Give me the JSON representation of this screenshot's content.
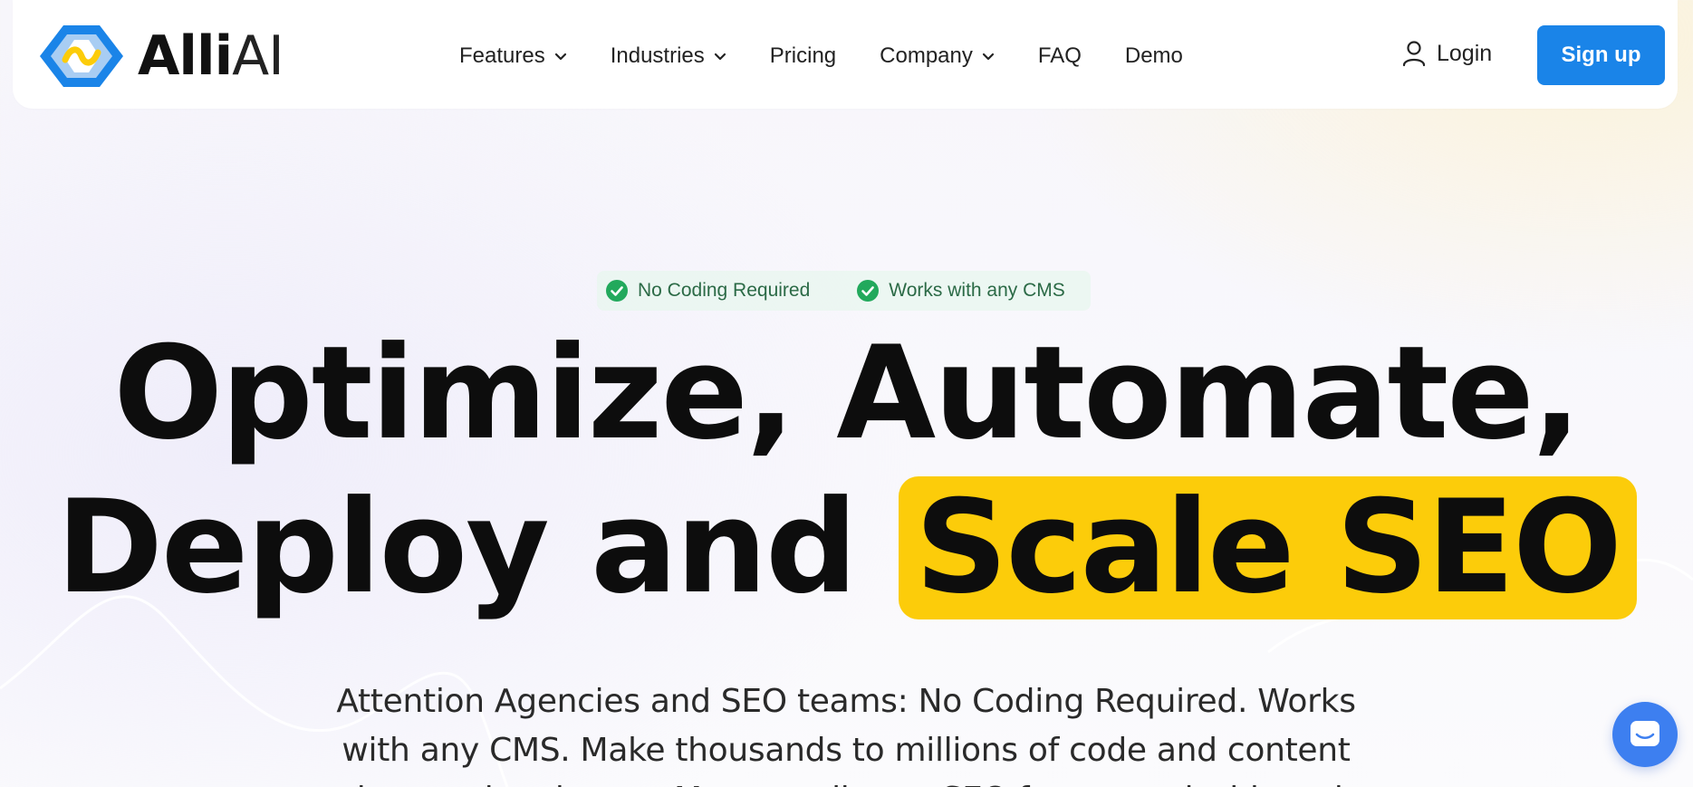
{
  "brand": {
    "name_bold": "Alli",
    "name_thin": "AI",
    "colors": {
      "blue": "#1a84e8",
      "light_blue": "#a8cdf3",
      "yellow": "#fccc0a"
    }
  },
  "nav": {
    "items": [
      {
        "label": "Features",
        "has_dropdown": true
      },
      {
        "label": "Industries",
        "has_dropdown": true
      },
      {
        "label": "Pricing",
        "has_dropdown": false
      },
      {
        "label": "Company",
        "has_dropdown": true
      },
      {
        "label": "FAQ",
        "has_dropdown": false
      },
      {
        "label": "Demo",
        "has_dropdown": false
      }
    ],
    "login_label": "Login",
    "signup_label": "Sign up"
  },
  "hero": {
    "badges": [
      {
        "label": "No Coding Required",
        "icon": "check-circle-icon"
      },
      {
        "label": "Works with any CMS",
        "icon": "check-circle-icon"
      }
    ],
    "headline_line1": "Optimize, Automate,",
    "headline_line2_plain": "Deploy and",
    "headline_line2_highlight": "Scale SEO",
    "subtext": "Attention Agencies and SEO teams: No Coding Required. Works with any CMS. Make thousands to millions of code and content changes in minutes. Manage all your SEO from one dashboard."
  },
  "chat": {
    "icon": "chat-bubble-icon"
  }
}
